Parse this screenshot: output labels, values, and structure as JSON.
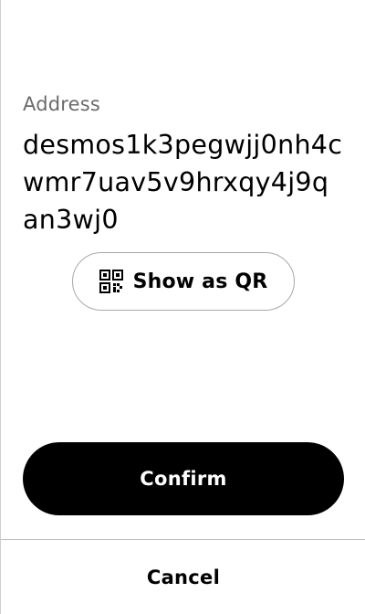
{
  "address": {
    "label": "Address",
    "value": "desmos1k3pegwjj0nh4cwmr7uav5v9hrxqy4j9qan3wj0"
  },
  "qr_button": {
    "label": "Show as QR",
    "icon": "qr-code-icon"
  },
  "actions": {
    "confirm_label": "Confirm",
    "cancel_label": "Cancel"
  },
  "colors": {
    "primary": "#000000",
    "on_primary": "#ffffff",
    "muted_text": "#6b6b6b",
    "outline": "#a9a9a9"
  }
}
